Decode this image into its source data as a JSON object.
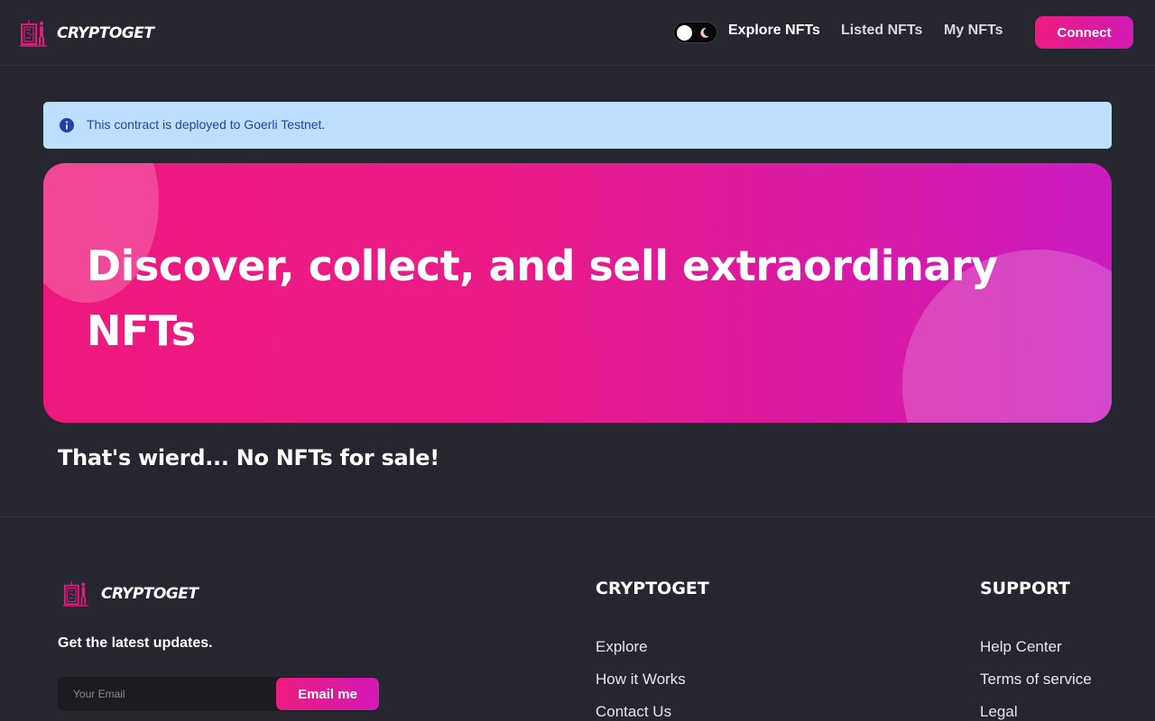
{
  "header": {
    "brand": "CRYPTOGET",
    "nav": {
      "explore": "Explore NFTs",
      "listed": "Listed NFTs",
      "my": "My NFTs"
    },
    "connect_label": "Connect"
  },
  "alert": {
    "text": "This contract is deployed to Goerli Testnet."
  },
  "hero": {
    "title": "Discover, collect, and sell extraordinary NFTs"
  },
  "empty_message": "That's wierd... No NFTs for sale!",
  "footer": {
    "brand": "CRYPTOGET",
    "updates_label": "Get the latest updates.",
    "email_placeholder": "Your Email",
    "email_button": "Email me",
    "col1": {
      "title": "CRYPTOGET",
      "links": [
        "Explore",
        "How it Works",
        "Contact Us"
      ]
    },
    "col2": {
      "title": "SUPPORT",
      "links": [
        "Help Center",
        "Terms of service",
        "Legal"
      ]
    }
  },
  "colors": {
    "background": "#25262f",
    "accent_start": "#ec1b80",
    "accent_end": "#d21ab6",
    "alert_bg": "#bee0ff",
    "alert_text": "#2343a6"
  },
  "icons": {
    "logo": "nft-gallery-logo",
    "theme_toggle": "moon-icon",
    "alert": "info-icon"
  }
}
